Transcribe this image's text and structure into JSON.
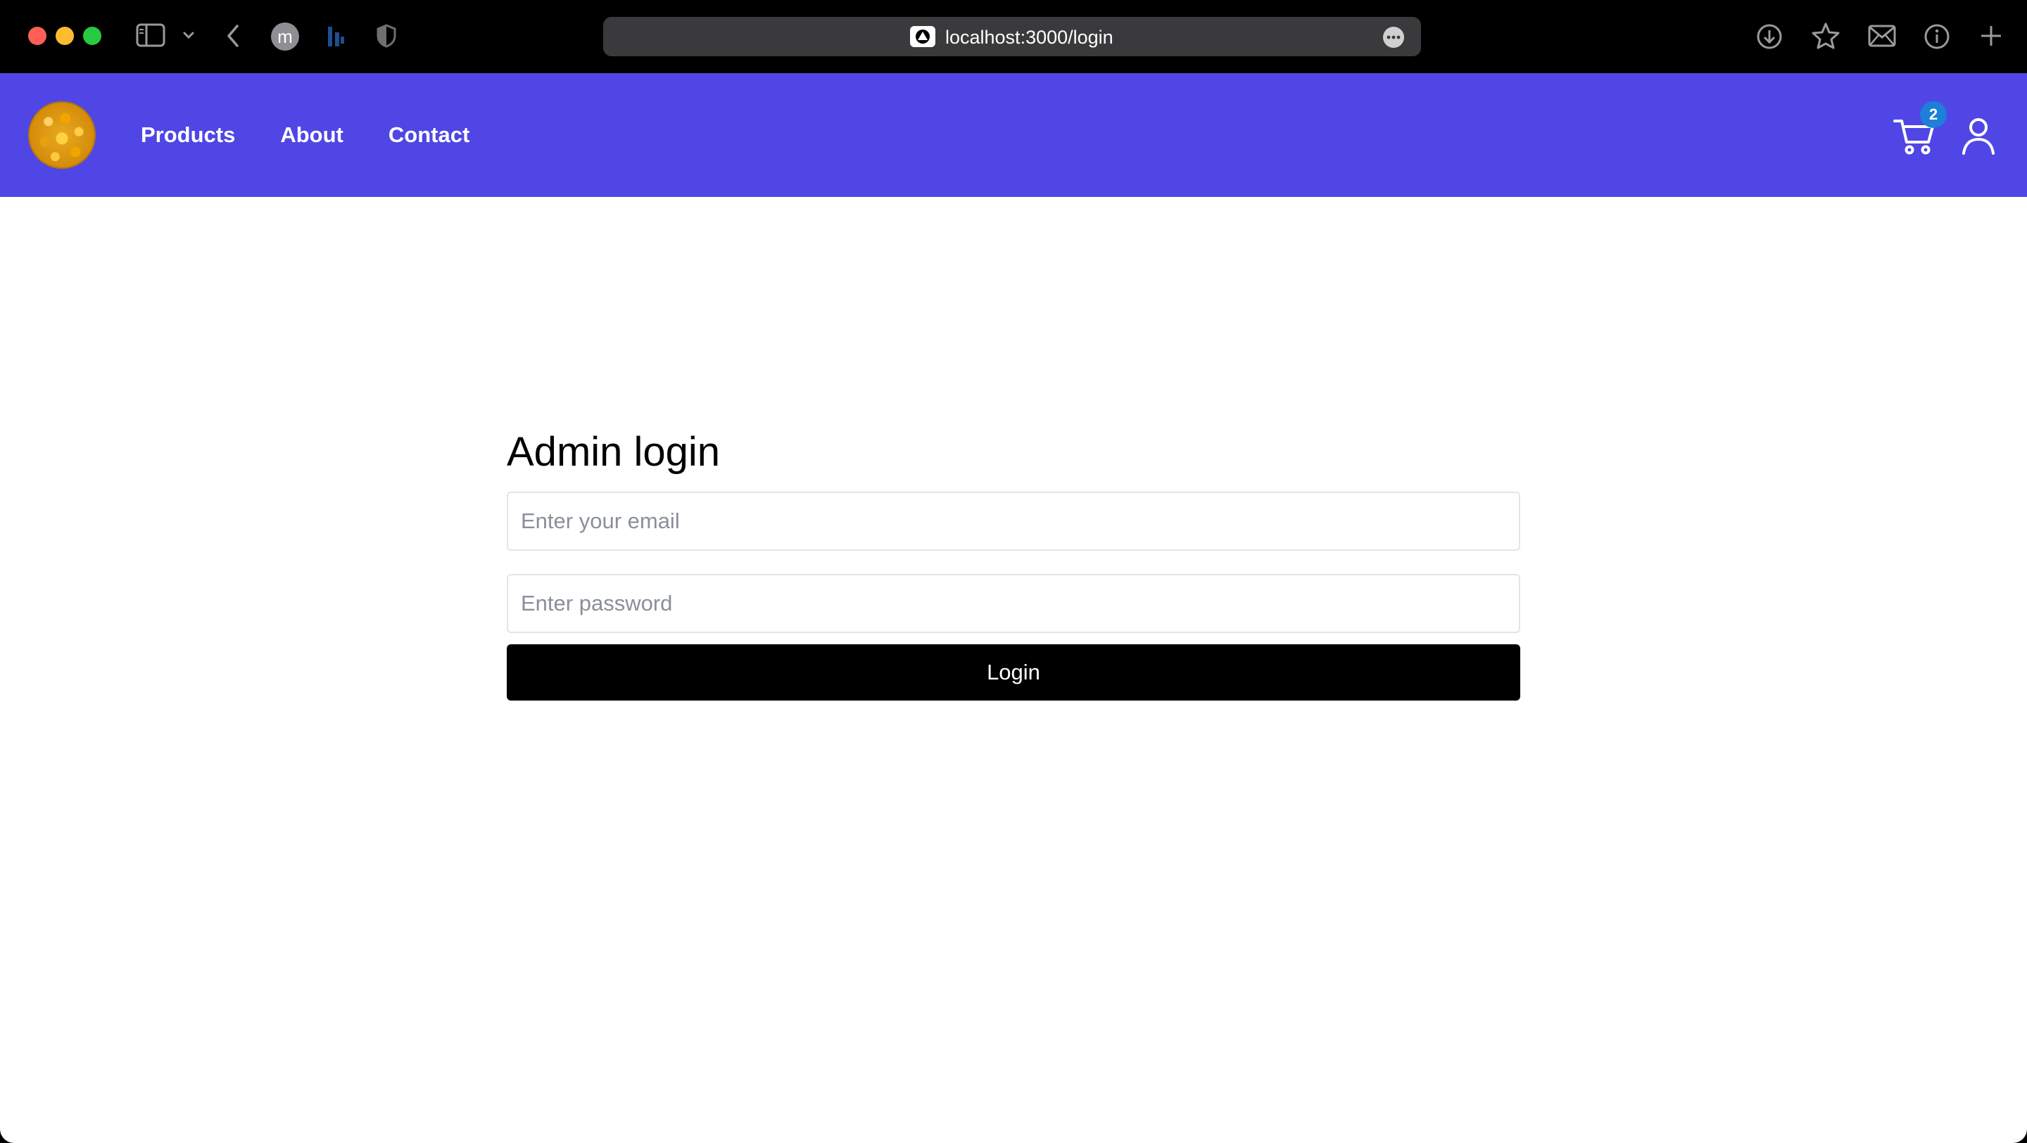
{
  "browser": {
    "url": "localhost:3000/login",
    "extension_m_letter": "m",
    "traffic_colors": {
      "close": "#ff5f57",
      "minimize": "#febc2e",
      "maximize": "#28c840"
    },
    "icons": [
      "sidebar-icon",
      "chevron-down-icon",
      "back-icon",
      "extension-icon",
      "bars-icon",
      "shield-icon",
      "page-favicon",
      "more-icon",
      "download-icon",
      "star-icon",
      "mail-icon",
      "info-icon",
      "plus-icon"
    ]
  },
  "navbar": {
    "background": "#4f46e5",
    "links": [
      "Products",
      "About",
      "Contact"
    ],
    "cart_count": "2",
    "badge_color": "#1d7fd8",
    "icons": [
      "logo",
      "cart-icon",
      "user-icon"
    ]
  },
  "login": {
    "title": "Admin login",
    "email_placeholder": "Enter your email",
    "password_placeholder": "Enter password",
    "button_label": "Login",
    "button_color": "#000000"
  }
}
